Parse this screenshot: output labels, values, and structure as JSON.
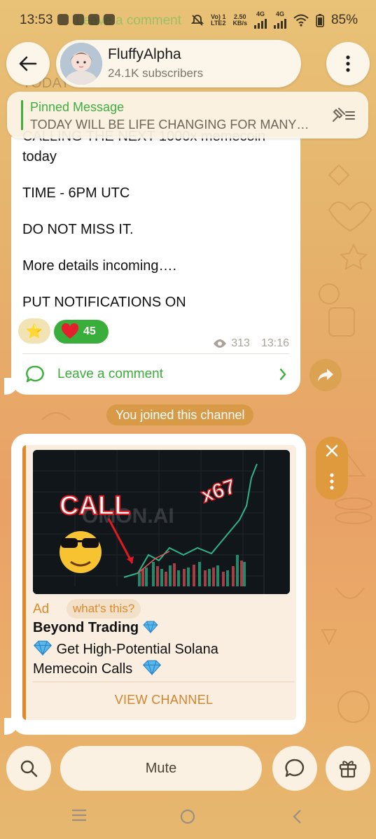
{
  "status_bar": {
    "time": "13:53",
    "ghost_text": "Leave a comment",
    "volte": "Vo) 1",
    "lte": "LTE2",
    "speed": "2.50",
    "speed_unit": "KB/s",
    "net1": "4G",
    "net2": "4G",
    "battery": "85%"
  },
  "header": {
    "channel_name": "FluffyAlpha",
    "subscribers": "24.1K subscribers"
  },
  "ghost_line": "TODAY WILL BE LIFE CHANGING FOR",
  "pinned": {
    "title": "Pinned Message",
    "text": "TODAY WILL BE LIFE CHANGING FOR MANY…"
  },
  "message": {
    "partial_top": "CALLING THE NEXT 1000x memecoin",
    "line1": "today",
    "line2": "TIME - 6PM UTC",
    "line3": "DO NOT MISS IT.",
    "line4": "More details incoming….",
    "line5": "PUT NOTIFICATIONS ON",
    "reaction_star": "⭐",
    "reaction_heart_count": "45",
    "views": "313",
    "time": "13:16",
    "comment_label": "Leave a comment"
  },
  "service_message": "You joined this channel",
  "ad": {
    "image_call_text": "CALL",
    "image_multiplier": "x67",
    "image_watermark": "OMON.AI",
    "badge": "Ad",
    "whats_this": "what's this?",
    "title": "Beyond Trading",
    "desc_text": "Get High-Potential Solana Memecoin Calls",
    "button": "VIEW CHANNEL"
  },
  "bottom_bar": {
    "mute_label": "Mute"
  },
  "colors": {
    "accent_green": "#3aae3a",
    "ad_orange": "#dc8a2a",
    "bubble": "#ffffff"
  }
}
